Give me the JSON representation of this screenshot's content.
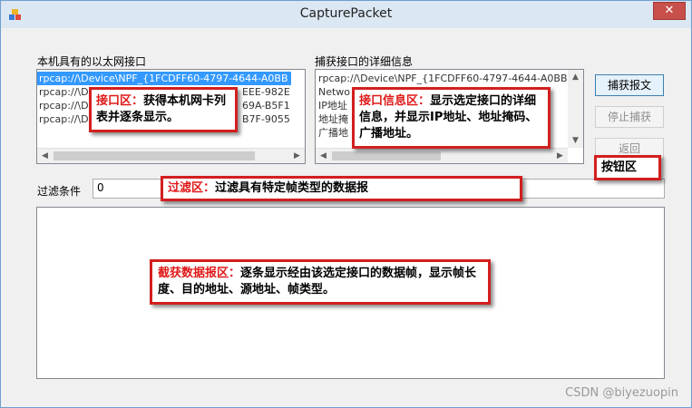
{
  "window": {
    "title": "CapturePacket",
    "close_glyph": "✕"
  },
  "interfaces": {
    "label": "本机具有的以太网接口",
    "items": [
      "rpcap://\\Device\\NPF_{1FCDFF60-4797-4644-A0BB",
      "rpcap://\\D",
      "rpcap://\\D",
      "rpcap://\\D"
    ],
    "items_tail": [
      "",
      "EEE-982E",
      "69A-B5F1",
      "B7F-9055"
    ]
  },
  "details": {
    "label": "捕获接口的详细信息",
    "lines": [
      "rpcap://\\Device\\NPF_{1FCDFF60-4797-4644-A0BB",
      "Netwo",
      "IP地址",
      "地址掩",
      "广播地"
    ]
  },
  "buttons": {
    "capture": "捕获报文",
    "stop": "停止捕获",
    "back": "返回"
  },
  "filter": {
    "label": "过滤条件",
    "value": "0"
  },
  "callouts": {
    "interface_title": "接口区：",
    "interface_body": "获得本机网卡列表并逐条显示。",
    "info_title": "接口信息区：",
    "info_body": "显示选定接口的详细信息，并显示IP地址、地址掩码、广播地址。",
    "button_area": "按钮区",
    "filter_title": "过滤区：",
    "filter_body": "过滤具有特定帧类型的数据报",
    "capture_title": "截获数据报区：",
    "capture_body": "逐条显示经由该选定接口的数据帧，显示帧长度、目的地址、源地址、帧类型。"
  },
  "watermark": "CSDN @biyezuopin",
  "colors": {
    "callout_border": "#d21f1f",
    "highlight_text": "#e01818",
    "selection": "#3399ff"
  }
}
